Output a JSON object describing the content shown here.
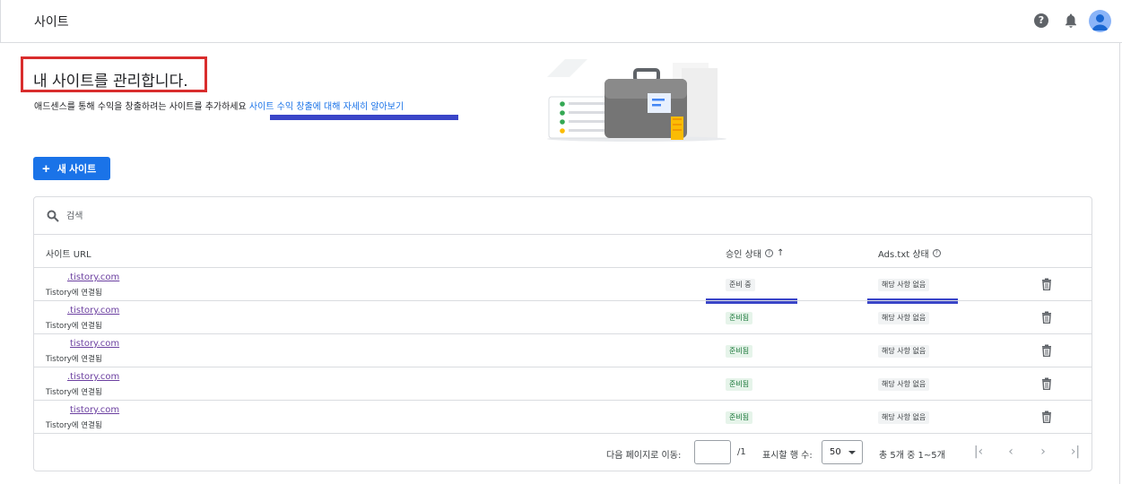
{
  "topbar": {
    "title": "사이트"
  },
  "intro": {
    "headline": "내 사이트를 관리합니다.",
    "description": "애드센스를 통해 수익을 창출하려는 사이트를 추가하세요",
    "learn_more_link": "사이트 수익 창출에 대해 자세히 알아보기"
  },
  "actions": {
    "new_site_label": "새 사이트"
  },
  "search": {
    "placeholder": "검색"
  },
  "table": {
    "headers": {
      "url": "사이트 URL",
      "approval": "승인 상태",
      "ads_txt": "Ads.txt 상태"
    },
    "rows": [
      {
        "url": ".tistory.com",
        "connection": "Tistory에 연결됨",
        "approval": "준비 중",
        "approval_kind": "pending",
        "ads_txt": "해당 사항 없음"
      },
      {
        "url": ".tistory.com",
        "connection": "Tistory에 연결됨",
        "approval": "준비됨",
        "approval_kind": "ready",
        "ads_txt": "해당 사항 없음"
      },
      {
        "url": "tistory.com",
        "connection": "Tistory에 연결됨",
        "approval": "준비됨",
        "approval_kind": "ready",
        "ads_txt": "해당 사항 없음"
      },
      {
        "url": ".tistory.com",
        "connection": "Tistory에 연결됨",
        "approval": "준비됨",
        "approval_kind": "ready",
        "ads_txt": "해당 사항 없음"
      },
      {
        "url": "tistory.com",
        "connection": "Tistory에 연결됨",
        "approval": "준비됨",
        "approval_kind": "ready",
        "ads_txt": "해당 사항 없음"
      }
    ]
  },
  "pagination": {
    "goto_label": "다음 페이지로 이동:",
    "page_value": "",
    "page_total": "/1",
    "rows_per_page_label": "표시할 행 수:",
    "rows_per_page": "50",
    "range_text": "총 5개 중 1~5개"
  },
  "colors": {
    "primary": "#1a73e8",
    "annotation_red": "#d92d2d",
    "annotation_blue": "#3a45c8",
    "ready_bg": "#e6f4ea",
    "ready_text": "#137333"
  }
}
